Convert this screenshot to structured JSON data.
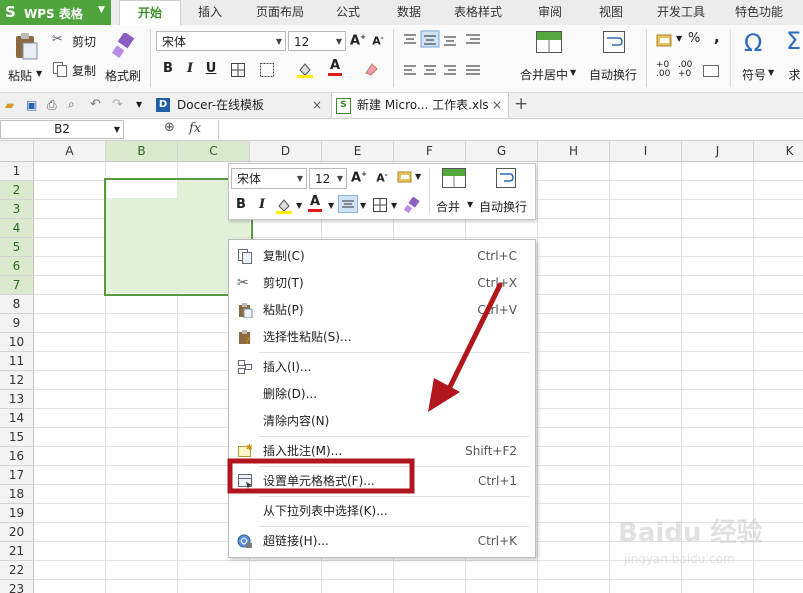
{
  "app": {
    "name": "WPS 表格"
  },
  "menu_tabs": [
    "开始",
    "插入",
    "页面布局",
    "公式",
    "数据",
    "表格样式",
    "审阅",
    "视图",
    "开发工具",
    "特色功能"
  ],
  "ribbon": {
    "paste": "粘贴",
    "cut": "剪切",
    "copy": "复制",
    "format_painter": "格式刷",
    "font_name": "宋体",
    "font_size": "12",
    "merge_center": "合并居中",
    "wrap_text": "自动换行",
    "symbol": "符号",
    "sum": "求和",
    "omega": "Ω",
    "sigma": "Σ",
    "percent": "%",
    "comma": ","
  },
  "doc_tabs": [
    {
      "label": "Docer-在线模板"
    },
    {
      "label": "新建 Micro... 工作表.xls"
    }
  ],
  "formula_bar": {
    "name_box": "B2",
    "fx": "fx"
  },
  "columns": [
    "A",
    "B",
    "C",
    "D",
    "E",
    "F",
    "G",
    "H",
    "I",
    "J",
    "K"
  ],
  "rows": [
    "1",
    "2",
    "3",
    "4",
    "5",
    "6",
    "7",
    "8",
    "9",
    "10",
    "11",
    "12",
    "13",
    "14",
    "15",
    "16",
    "17",
    "18",
    "19",
    "20",
    "21",
    "22",
    "23"
  ],
  "mini_toolbar": {
    "font": "宋体",
    "size": "12",
    "merge": "合并",
    "wrap": "自动换行"
  },
  "context_menu": [
    {
      "label": "复制(C)",
      "shortcut": "Ctrl+C",
      "icon": "copy-icon"
    },
    {
      "label": "剪切(T)",
      "shortcut": "Ctrl+X",
      "icon": "scissors-icon"
    },
    {
      "label": "粘贴(P)",
      "shortcut": "Ctrl+V",
      "icon": "paste-icon"
    },
    {
      "label": "选择性粘贴(S)...",
      "shortcut": "",
      "icon": "paste-special-icon"
    },
    {
      "label": "插入(I)...",
      "shortcut": "",
      "icon": "insert-icon"
    },
    {
      "label": "删除(D)...",
      "shortcut": "",
      "icon": ""
    },
    {
      "label": "清除内容(N)",
      "shortcut": "",
      "icon": ""
    },
    {
      "label": "插入批注(M)...",
      "shortcut": "Shift+F2",
      "icon": "comment-icon"
    },
    {
      "label": "设置单元格格式(F)...",
      "shortcut": "Ctrl+1",
      "icon": "format-cells-icon"
    },
    {
      "label": "从下拉列表中选择(K)...",
      "shortcut": "",
      "icon": ""
    },
    {
      "label": "超链接(H)...",
      "shortcut": "Ctrl+K",
      "icon": "hyperlink-icon"
    }
  ],
  "colors": {
    "accent": "#4fa43c",
    "selection_fill": "#e2f0d9",
    "selection_border": "#5a9a3c",
    "annotation": "#b0161c"
  },
  "watermark": {
    "text": "Baidu 经验",
    "sub": "jingyan.baidu.com"
  }
}
